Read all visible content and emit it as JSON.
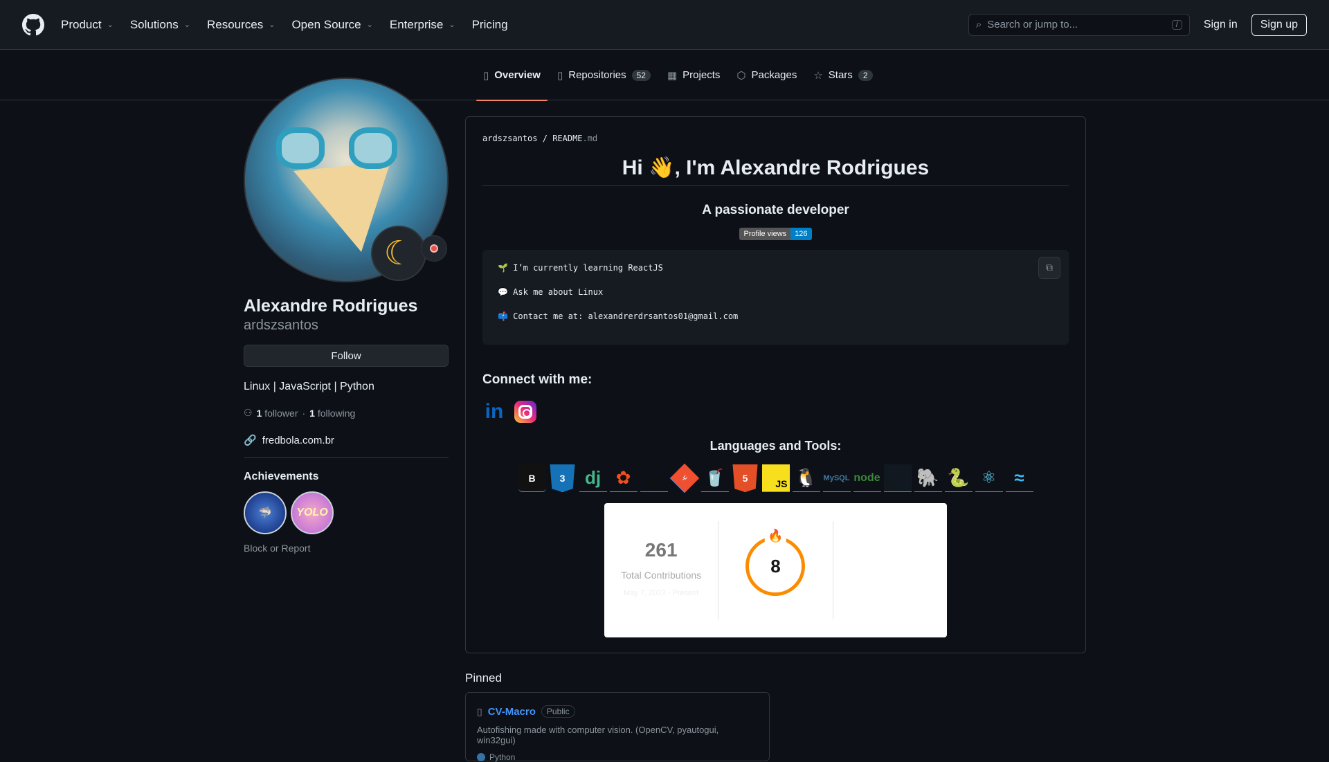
{
  "header": {
    "nav": [
      {
        "label": "Product",
        "has_menu": true
      },
      {
        "label": "Solutions",
        "has_menu": true
      },
      {
        "label": "Resources",
        "has_menu": true
      },
      {
        "label": "Open Source",
        "has_menu": true
      },
      {
        "label": "Enterprise",
        "has_menu": true
      },
      {
        "label": "Pricing",
        "has_menu": false
      }
    ],
    "search_placeholder": "Search or jump to...",
    "search_shortcut": "/",
    "signin": "Sign in",
    "signup": "Sign up"
  },
  "tabs": [
    {
      "label": "Overview",
      "icon": "book-icon",
      "active": true
    },
    {
      "label": "Repositories",
      "icon": "repo-icon",
      "count": "52"
    },
    {
      "label": "Projects",
      "icon": "table-icon"
    },
    {
      "label": "Packages",
      "icon": "package-icon"
    },
    {
      "label": "Stars",
      "icon": "star-icon",
      "count": "2"
    }
  ],
  "profile": {
    "fullname": "Alexandre Rodrigues",
    "username": "ardszsantos",
    "follow_label": "Follow",
    "bio": "Linux | JavaScript | Python",
    "followers_count": "1",
    "followers_label": "follower",
    "following_count": "1",
    "following_label": "following",
    "website": "fredbola.com.br",
    "achievements_title": "Achievements",
    "block_label": "Block or Report"
  },
  "readme": {
    "crumb_user": "ardszsantos",
    "crumb_sep": "/",
    "crumb_file": "README",
    "crumb_ext": ".md",
    "title": "Hi 👋, I'm Alexandre Rodrigues",
    "subtitle": "A passionate developer",
    "views_label": "Profile views",
    "views_count": "126",
    "lines": [
      "🌱 I’m currently learning ReactJS",
      "💬 Ask me about Linux",
      "📫 Contact me at: alexandrerdrsantos01@gmail.com"
    ],
    "connect_title": "Connect with me:",
    "languages_title": "Languages and Tools:",
    "streak": {
      "total": "261",
      "total_label": "Total Contributions",
      "range": "May 7, 2023 - Present",
      "current": "8"
    }
  },
  "pinned": {
    "title": "Pinned",
    "repo_name": "CV-Macro",
    "visibility": "Public",
    "description": "Autofishing made with computer vision. (OpenCV, pyautogui, win32gui)",
    "language": "Python"
  },
  "colors": {
    "accent": "#f78166",
    "link": "#4493f8",
    "streak_orange": "#fb8c00"
  }
}
